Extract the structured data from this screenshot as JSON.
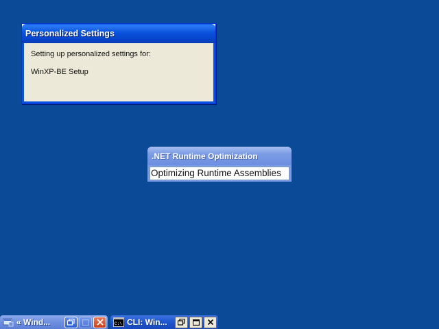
{
  "personalized_settings": {
    "title": "Personalized Settings",
    "message": "Setting up personalized settings for:",
    "target": "WinXP-BE Setup"
  },
  "net_runtime": {
    "title": ".NET Runtime Optimization",
    "status": "Optimizing Runtime Assemblies"
  },
  "taskbar": {
    "items": [
      {
        "label": "« Wind...",
        "icon": "windows-setup-icon",
        "controls": [
          "restore-icon",
          "maximize-icon",
          "close-icon"
        ]
      },
      {
        "label": "CLI: Win...",
        "icon": "command-prompt-icon",
        "controls": [
          "restore-icon",
          "maximize-icon",
          "close-icon"
        ]
      }
    ]
  },
  "colors": {
    "desktop": "#0a4a96",
    "title_bar_active": "#0a52dd",
    "title_bar_inactive": "#7b9be6",
    "dialog_face": "#ece9d8",
    "close_button": "#c8401e"
  }
}
